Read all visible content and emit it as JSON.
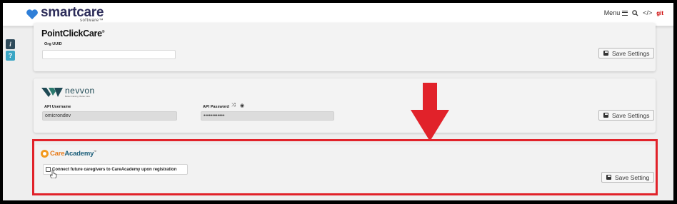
{
  "header": {
    "logo_main": "smartcare",
    "logo_sub": "software™",
    "menu_label": "Menu",
    "icons": [
      "hamburger-icon",
      "search-icon",
      "code-icon",
      "git-icon"
    ],
    "git_label": "git"
  },
  "side_tabs": {
    "info": "i",
    "help": "?"
  },
  "pointclickcare": {
    "logo": "PointClickCare",
    "logo_tm": "®",
    "org_uuid_label": "Org UUID",
    "org_uuid_value": "",
    "save_label": "Save Settings"
  },
  "nevvon": {
    "logo": "nevvon",
    "tagline": "Better training. Better care.",
    "api_username_label": "API Username",
    "api_username_value": "omicrondev",
    "api_password_label": "API Password",
    "api_password_value": "••••••••••••",
    "save_label": "Save Settings"
  },
  "careacademy": {
    "logo_care": "Care",
    "logo_academy": "Academy",
    "logo_tm": "™",
    "checkbox_label": "Connect future caregivers to CareAcademy upon registration",
    "checkbox_checked": false,
    "save_label": "Save Setting"
  },
  "colors": {
    "highlight_red": "#e1222a",
    "brand_navy": "#2d2d5a",
    "brand_blue": "#2f7fd8"
  }
}
